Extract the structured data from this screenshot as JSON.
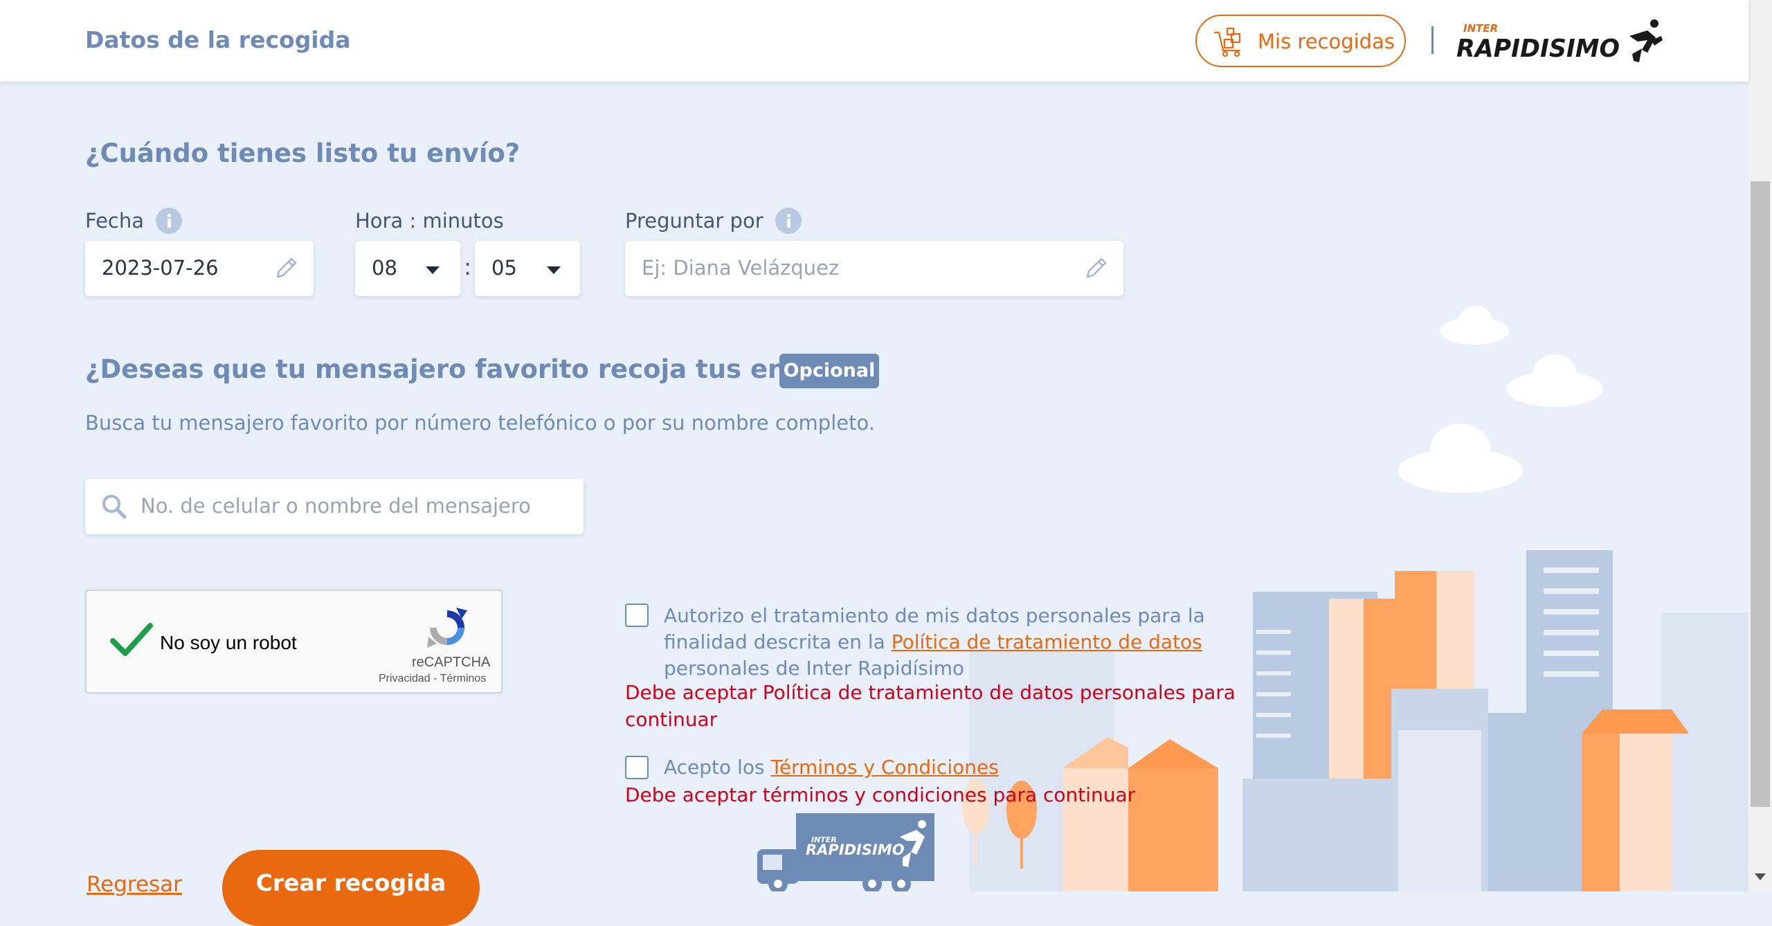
{
  "header": {
    "title": "Datos de la recogida",
    "my_pickups_label": "Mis recogidas",
    "logo_text": "INTER RAPIDISIMO"
  },
  "when_section": {
    "title": "¿Cuándo tienes listo tu envío?",
    "date_label": "Fecha",
    "date_value": "2023-07-26",
    "time_label": "Hora : minutos",
    "hour_value": "08",
    "minute_value": "05",
    "time_separator": ":",
    "ask_for_label": "Preguntar por",
    "ask_for_placeholder": "Ej: Diana Velázquez"
  },
  "favorite_section": {
    "title": "¿Deseas que tu mensajero favorito recoja tus envíos?",
    "badge": "Opcional",
    "description": "Busca tu mensajero favorito por número telefónico o por su nombre completo.",
    "search_placeholder": "No. de celular o nombre del mensajero"
  },
  "captcha": {
    "label": "No soy un robot",
    "brand": "reCAPTCHA",
    "links": "Privacidad - Términos"
  },
  "consent": {
    "privacy_text_before": "Autorizo el tratamiento de mis datos personales para la finalidad descrita en la ",
    "privacy_link": "Política de tratamiento de datos ",
    "privacy_text_after": "personales de Inter Rapidísimo",
    "privacy_error": "Debe aceptar Política de tratamiento de datos personales para continuar",
    "terms_text_before": "Acepto los ",
    "terms_link": "Términos y Condiciones",
    "terms_error": "Debe aceptar términos y condiciones para continuar"
  },
  "actions": {
    "back_label": "Regresar",
    "create_label": "Crear recogida"
  },
  "truck": {
    "brand_small": "INTER",
    "brand": "RAPIDISIMO"
  },
  "colors": {
    "accent_orange": "#e8690f",
    "primary_blue": "#6d8bb5",
    "error_red": "#d0021b",
    "background": "#eaf0f9"
  }
}
